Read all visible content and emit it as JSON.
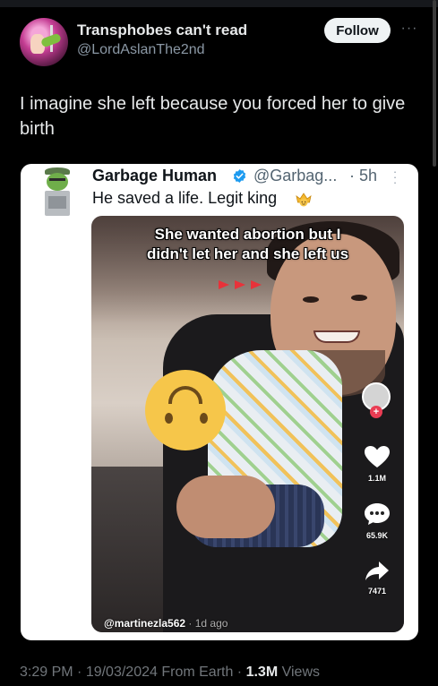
{
  "tweet": {
    "author": {
      "display_name": "Transphobes can't read",
      "handle": "@LordAslanThe2nd"
    },
    "follow_label": "Follow",
    "text": "I imagine she left because you forced her to give birth",
    "meta": {
      "time": "3:29 PM",
      "date": "19/03/2024",
      "source": "From Earth",
      "views_count": "1.3M",
      "views_label": "Views"
    }
  },
  "quote": {
    "author": {
      "display_name": "Garbage Human",
      "handle": "@Garbag...",
      "time": "· 5h"
    },
    "text": "He saved a life. Legit king",
    "video": {
      "caption_line1": "She wanted abortion but I",
      "caption_line2": "didn't let her and she left us",
      "handle": "@martinezla562",
      "ago": " · 1d ago",
      "likes": "1.1M",
      "comments": "65.9K",
      "shares": "7471"
    }
  },
  "colors": {
    "background": "#000000",
    "card_background": "#ffffff",
    "verified": "#1d9bf0",
    "follow_button": "#eff3f4",
    "muted_text": "#71767b"
  }
}
